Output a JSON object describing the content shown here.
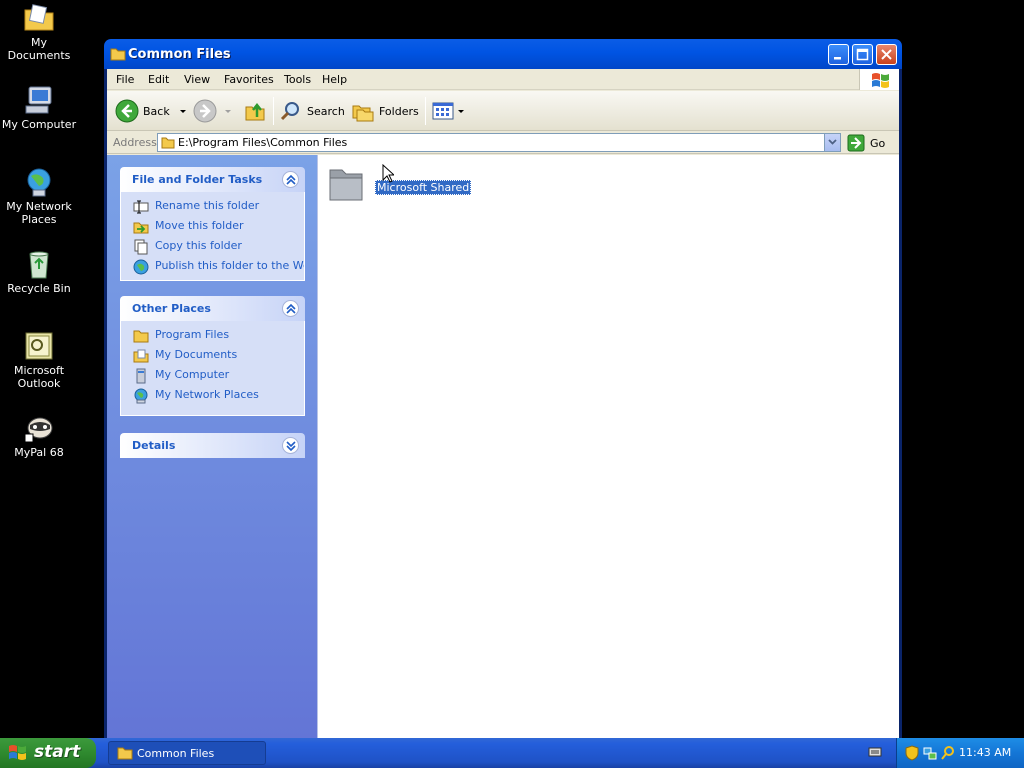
{
  "desktop": {
    "icons": [
      {
        "label": "My Documents"
      },
      {
        "label": "My Computer"
      },
      {
        "label": "My Network Places"
      },
      {
        "label": "Recycle Bin"
      },
      {
        "label": "Microsoft Outlook"
      },
      {
        "label": "MyPal 68"
      }
    ]
  },
  "window": {
    "title": "Common Files",
    "menu": [
      "File",
      "Edit",
      "View",
      "Favorites",
      "Tools",
      "Help"
    ],
    "toolbar": {
      "back_label": "Back",
      "search_label": "Search",
      "folders_label": "Folders"
    },
    "address": {
      "label": "Address",
      "value": "E:\\Program Files\\Common Files",
      "go_label": "Go"
    },
    "task_pane": {
      "file_tasks": {
        "title": "File and Folder Tasks",
        "items": [
          "Rename this folder",
          "Move this folder",
          "Copy this folder",
          "Publish this folder to the Web"
        ]
      },
      "other_places": {
        "title": "Other Places",
        "items": [
          "Program Files",
          "My Documents",
          "My Computer",
          "My Network Places"
        ]
      },
      "details": {
        "title": "Details"
      }
    },
    "files": [
      {
        "name": "Microsoft Shared",
        "selected": true
      }
    ]
  },
  "taskbar": {
    "start_label": "start",
    "task_button_label": "Common Files",
    "clock": "11:43 AM"
  },
  "colors": {
    "title_blue": "#0054e3",
    "taskpane_link": "#215dc6",
    "selection": "#316ac5",
    "start_green": "#2f8a2f"
  }
}
